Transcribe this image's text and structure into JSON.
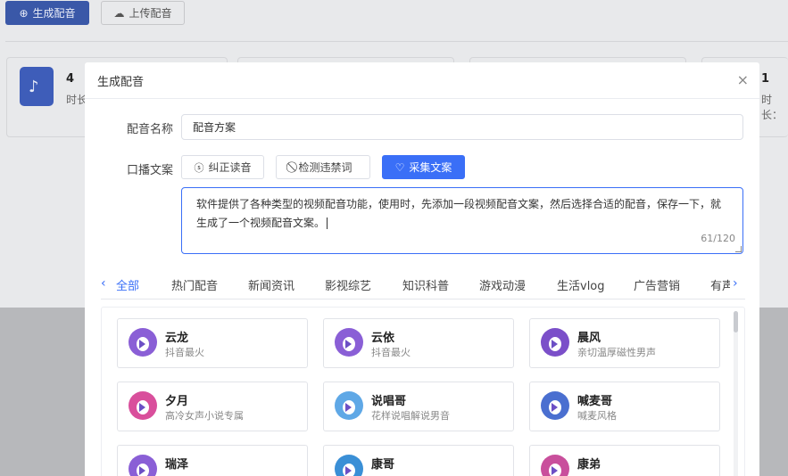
{
  "background": {
    "generate_button": "生成配音",
    "upload_button": "上传配音",
    "stat_cards": [
      {
        "value": "4",
        "label": "时长"
      },
      {
        "value": "1",
        "label": "时长："
      }
    ]
  },
  "modal": {
    "title": "生成配音",
    "close_icon": "×",
    "name_label": "配音名称",
    "name_value": "配音方案",
    "script_label": "口播文案",
    "buttons": {
      "correct_reading": "纠正读音",
      "detect_banned": "检测违禁词",
      "collect_script": "采集文案"
    },
    "script_text": "软件提供了各种类型的视频配音功能，使用时，先添加一段视频配音文案，然后选择合适的配音，保存一下，就生成了一个视频配音文案。",
    "char_count": "61/120",
    "tabs": [
      "全部",
      "热门配音",
      "新闻资讯",
      "影视综艺",
      "知识科普",
      "游戏动漫",
      "生活vlog",
      "广告营销",
      "有声"
    ],
    "active_tab": "全部",
    "voices": [
      {
        "name": "云龙",
        "desc": "抖音最火",
        "color": "#8a5fd6"
      },
      {
        "name": "云依",
        "desc": "抖音最火",
        "color": "#8a5fd6"
      },
      {
        "name": "晨风",
        "desc": "亲切温厚磁性男声",
        "color": "#7b4fc9"
      },
      {
        "name": "夕月",
        "desc": "高冷女声小说专属",
        "color": "#d94f9c"
      },
      {
        "name": "说唱哥",
        "desc": "花样说唱解说男音",
        "color": "#5fa8e6"
      },
      {
        "name": "喊麦哥",
        "desc": "喊麦风格",
        "color": "#4a6fd0"
      },
      {
        "name": "瑞泽",
        "desc": "",
        "color": "#8a5fd6"
      },
      {
        "name": "康哥",
        "desc": "",
        "color": "#3a8fd6"
      },
      {
        "name": "康弟",
        "desc": "",
        "color": "#c94f9c"
      }
    ]
  },
  "colors": {
    "accent": "#3a6ff7",
    "dark_accent": "#3a58a8"
  }
}
